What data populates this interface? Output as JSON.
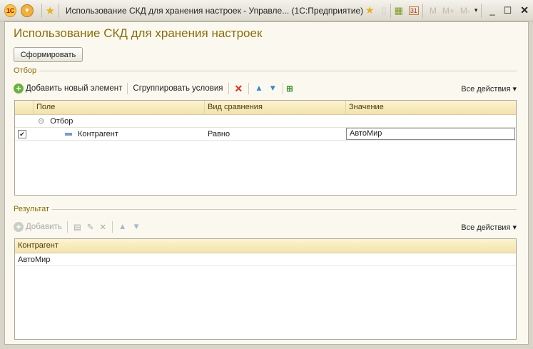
{
  "titlebar": {
    "title": "Использование СКД для хранения настроек - Управле...  (1С:Предприятие)",
    "logo": "1С",
    "calendar": "31",
    "m": "M",
    "mplus": "M+",
    "mminus": "M-"
  },
  "form": {
    "title": "Использование СКД для хранения настроек",
    "generate_button": "Сформировать"
  },
  "filter": {
    "group_label": "Отбор",
    "add_label": "Добавить новый элемент",
    "group_label_btn": "Сгруппировать условия",
    "all_actions": "Все действия ▾",
    "columns": [
      "Поле",
      "Вид сравнения",
      "Значение"
    ],
    "root": "Отбор",
    "rows": [
      {
        "field": "Контрагент",
        "comparison": "Равно",
        "value": "АвтоМир",
        "checked": true
      }
    ]
  },
  "result": {
    "group_label": "Результат",
    "add_label": "Добавить",
    "all_actions": "Все действия ▾",
    "columns": [
      "Контрагент"
    ],
    "rows": [
      {
        "c0": "АвтоМир"
      }
    ]
  }
}
